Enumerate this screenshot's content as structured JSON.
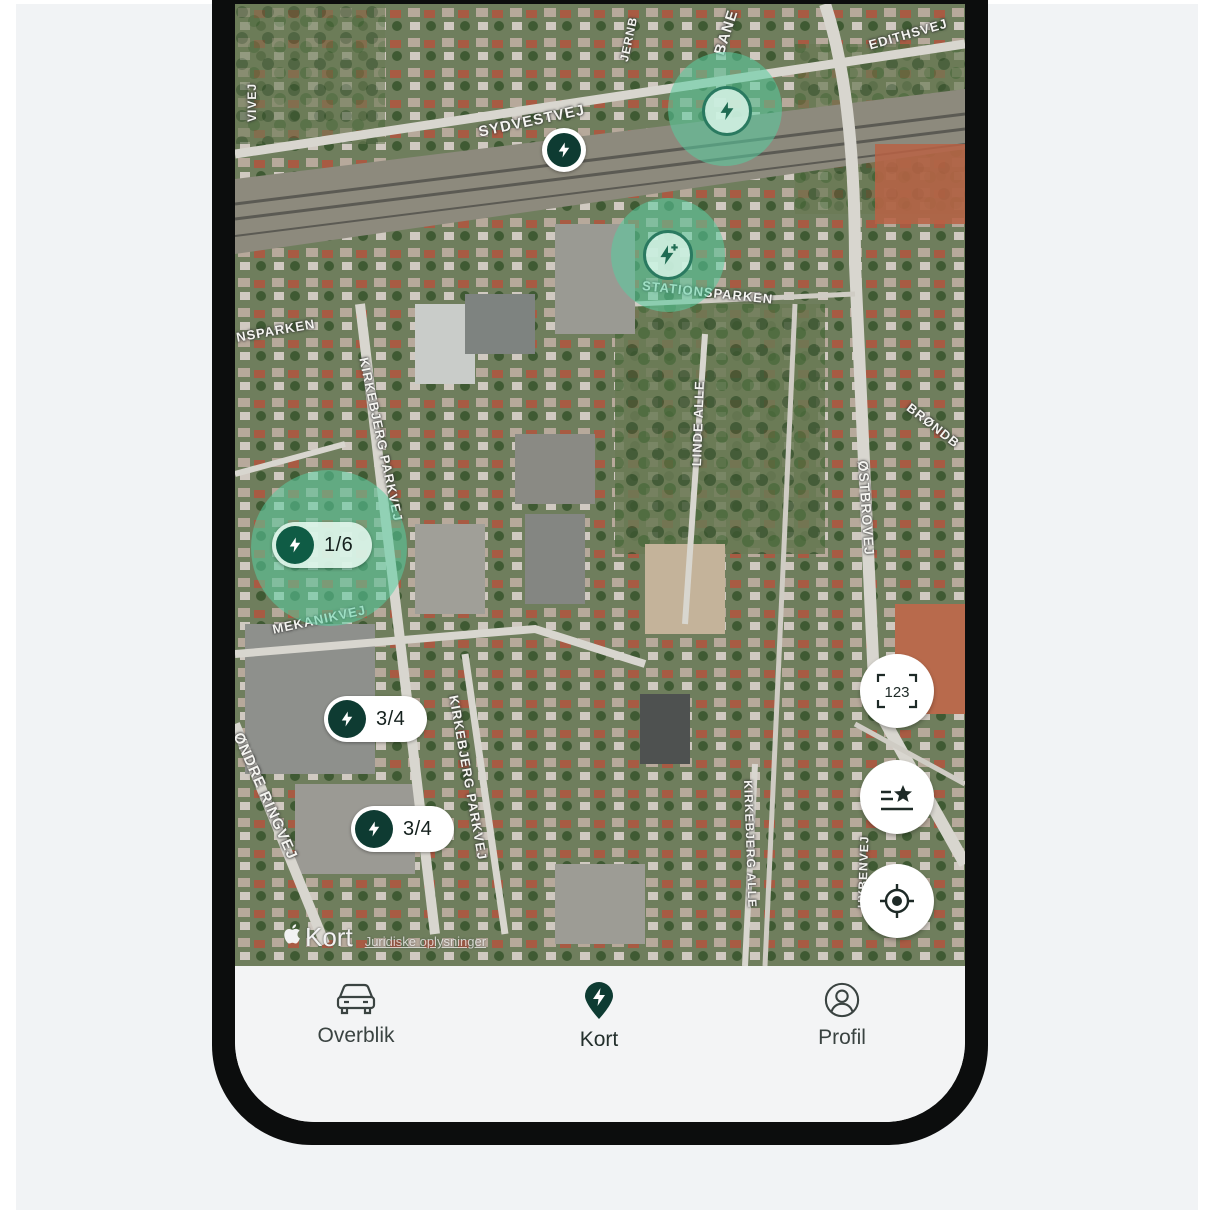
{
  "map": {
    "streets": [
      {
        "text": "SYDVESTVEJ"
      },
      {
        "text": "EDITHSVEJ"
      },
      {
        "text": "BANE"
      },
      {
        "text": "JERNB"
      },
      {
        "text": "STATIONSPARKEN"
      },
      {
        "text": "NSPARKEN"
      },
      {
        "text": "KIRKEBJERG PARKVEJ"
      },
      {
        "text": "LINDE ALLE"
      },
      {
        "text": "ØSTBROVEJ"
      },
      {
        "text": "BRØNDB"
      },
      {
        "text": "MEKANIKVEJ"
      },
      {
        "text": "ØNDRE RINGVEJ"
      },
      {
        "text": "KIRKEBJERG PARKVEJ"
      },
      {
        "text": "KIRKEBJERG ALLE"
      },
      {
        "text": "HYBENVEJ"
      },
      {
        "text": "VIVEJ"
      }
    ],
    "chargers": [
      {
        "name": "charger-pill-mekanikvej",
        "count": "1/6"
      },
      {
        "name": "charger-pill-south-1",
        "count": "3/4"
      },
      {
        "name": "charger-pill-south-2",
        "count": "3/4"
      }
    ],
    "attribution": {
      "brand": "Kort",
      "legal": "Juridiske oplysninger"
    },
    "controls": {
      "ocr_label": "123"
    }
  },
  "tabbar": {
    "items": [
      {
        "label": "Overblik",
        "icon": "car-icon",
        "active": false
      },
      {
        "label": "Kort",
        "icon": "map-pin-bolt-icon",
        "active": true
      },
      {
        "label": "Profil",
        "icon": "user-circle-icon",
        "active": false
      }
    ]
  },
  "colors": {
    "brand_dark": "#0e3b32",
    "halo": "#58cea0",
    "tabbar_bg": "#f3f4f5"
  }
}
